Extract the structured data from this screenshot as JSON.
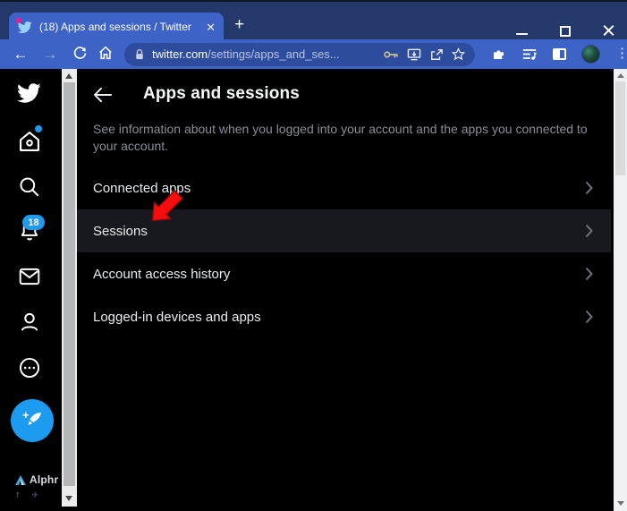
{
  "browser": {
    "tab": {
      "title": "(18) Apps and sessions / Twitter",
      "close_glyph": "✕"
    },
    "new_tab_glyph": "+",
    "nav": {
      "back_glyph": "←",
      "forward_glyph": "→"
    },
    "url": {
      "domain": "twitter.com",
      "path": "/settings/apps_and_ses..."
    },
    "menu_dots_glyph": "⋮"
  },
  "page": {
    "header": {
      "title": "Apps and sessions"
    },
    "description": "See information about when you logged into your account and the apps you connected to your account.",
    "menu": [
      {
        "label": "Connected apps",
        "highlighted": false
      },
      {
        "label": "Sessions",
        "highlighted": true
      },
      {
        "label": "Account access history",
        "highlighted": false
      },
      {
        "label": "Logged-in devices and apps",
        "highlighted": false
      }
    ],
    "notifications_badge": "18",
    "watermark": "Alphr"
  },
  "colors": {
    "frame": "#24386b",
    "toolbar": "#3d63c6",
    "urlbar": "#2e4c9e",
    "page_background": "#000000",
    "row_highlight": "#17191e",
    "twitter_accent": "#1d9bf0",
    "annotation_arrow": "#f50d0d",
    "text_primary": "#e9ebee",
    "text_secondary": "#878e97"
  }
}
